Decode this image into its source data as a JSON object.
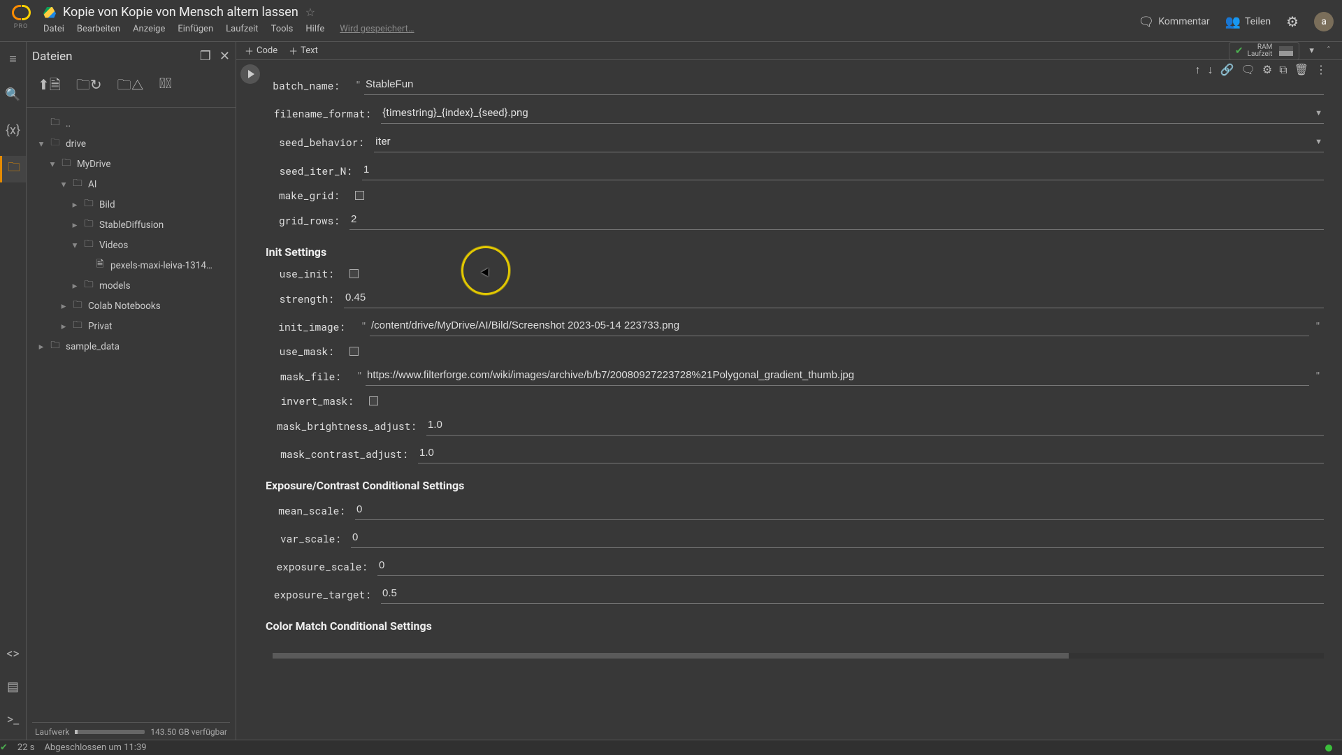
{
  "header": {
    "pro": "PRO",
    "title": "Kopie von Kopie von Mensch altern lassen",
    "menu": [
      "Datei",
      "Bearbeiten",
      "Anzeige",
      "Einfügen",
      "Laufzeit",
      "Tools",
      "Hilfe"
    ],
    "saving": "Wird gespeichert…",
    "comment": "Kommentar",
    "share": "Teilen",
    "avatar": "a"
  },
  "files": {
    "title": "Dateien",
    "tree": {
      "root": "..",
      "drive": "drive",
      "mydrive": "MyDrive",
      "ai": "AI",
      "bild": "Bild",
      "stable": "StableDiffusion",
      "videos": "Videos",
      "video_file": "pexels-maxi-leiva-1314…",
      "models": "models",
      "colabnb": "Colab Notebooks",
      "privat": "Privat",
      "sample": "sample_data"
    },
    "footer_label": "Laufwerk",
    "footer_free": "143.50 GB verfügbar"
  },
  "nb_toolbar": {
    "add_code": "Code",
    "add_text": "Text",
    "ram": "RAM",
    "runtime": "Laufzeit"
  },
  "form": {
    "batch_name": {
      "label": "batch_name:",
      "value": "StableFun"
    },
    "filename_format": {
      "label": "filename_format:",
      "value": "{timestring}_{index}_{seed}.png"
    },
    "seed_behavior": {
      "label": "seed_behavior:",
      "value": "iter"
    },
    "seed_iter_N": {
      "label": "seed_iter_N:",
      "value": "1"
    },
    "make_grid": {
      "label": "make_grid:"
    },
    "grid_rows": {
      "label": "grid_rows:",
      "value": "2"
    },
    "section_init": "Init Settings",
    "use_init": {
      "label": "use_init:"
    },
    "strength": {
      "label": "strength:",
      "value": "0.45"
    },
    "init_image": {
      "label": "init_image:",
      "value": "/content/drive/MyDrive/AI/Bild/Screenshot 2023-05-14 223733.png"
    },
    "use_mask": {
      "label": "use_mask:"
    },
    "mask_file": {
      "label": "mask_file:",
      "value": "https://www.filterforge.com/wiki/images/archive/b/b7/20080927223728%21Polygonal_gradient_thumb.jpg"
    },
    "invert_mask": {
      "label": "invert_mask:"
    },
    "mask_brightness_adjust": {
      "label": "mask_brightness_adjust:",
      "value": "1.0"
    },
    "mask_contrast_adjust": {
      "label": "mask_contrast_adjust:",
      "value": "1.0"
    },
    "section_exposure": "Exposure/Contrast Conditional Settings",
    "mean_scale": {
      "label": "mean_scale:",
      "value": "0"
    },
    "var_scale": {
      "label": "var_scale:",
      "value": "0"
    },
    "exposure_scale": {
      "label": "exposure_scale:",
      "value": "0"
    },
    "exposure_target": {
      "label": "exposure_target:",
      "value": "0.5"
    },
    "section_color": "Color Match Conditional Settings"
  },
  "status": {
    "secs": "22 s",
    "msg": "Abgeschlossen um 11:39"
  }
}
